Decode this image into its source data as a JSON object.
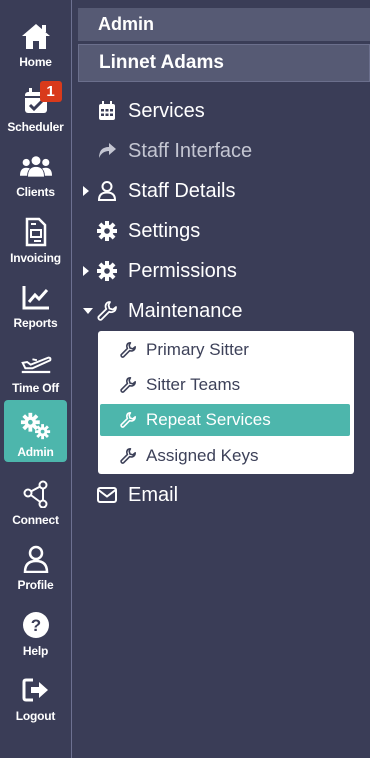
{
  "rail": {
    "items": [
      {
        "id": "home",
        "label": "Home",
        "icon": "home-icon"
      },
      {
        "id": "scheduler",
        "label": "Scheduler",
        "icon": "calendar-check-icon",
        "badge": "1"
      },
      {
        "id": "clients",
        "label": "Clients",
        "icon": "users-icon"
      },
      {
        "id": "invoicing",
        "label": "Invoicing",
        "icon": "invoice-icon"
      },
      {
        "id": "reports",
        "label": "Reports",
        "icon": "chart-line-icon"
      },
      {
        "id": "timeoff",
        "label": "Time Off",
        "icon": "plane-departure-icon"
      },
      {
        "id": "admin",
        "label": "Admin",
        "icon": "gears-icon",
        "active": true
      },
      {
        "id": "connect",
        "label": "Connect",
        "icon": "share-nodes-icon"
      },
      {
        "id": "profile",
        "label": "Profile",
        "icon": "user-icon"
      },
      {
        "id": "help",
        "label": "Help",
        "icon": "question-circle-icon"
      },
      {
        "id": "logout",
        "label": "Logout",
        "icon": "sign-out-icon"
      }
    ]
  },
  "main": {
    "section_title": "Admin",
    "user_name": "Linnet Adams",
    "menu": [
      {
        "label": "Services",
        "icon": "calendar-icon"
      },
      {
        "label": "Staff Interface",
        "icon": "share-arrow-icon"
      },
      {
        "label": "Staff Details",
        "icon": "user-outline-icon",
        "caret": "collapsed"
      },
      {
        "label": "Settings",
        "icon": "gear-icon"
      },
      {
        "label": "Permissions",
        "icon": "gear-icon",
        "caret": "collapsed"
      },
      {
        "label": "Maintenance",
        "icon": "wrench-icon",
        "caret": "expanded"
      },
      {
        "label": "Email",
        "icon": "envelope-icon"
      }
    ],
    "maintenance_items": [
      {
        "label": "Primary Sitter"
      },
      {
        "label": "Sitter Teams"
      },
      {
        "label": "Repeat Services",
        "active": true
      },
      {
        "label": "Assigned Keys"
      }
    ]
  },
  "colors": {
    "background": "#3a3d57",
    "header": "#565a74",
    "accent": "#4db6ac",
    "badge": "#d93a1b"
  }
}
